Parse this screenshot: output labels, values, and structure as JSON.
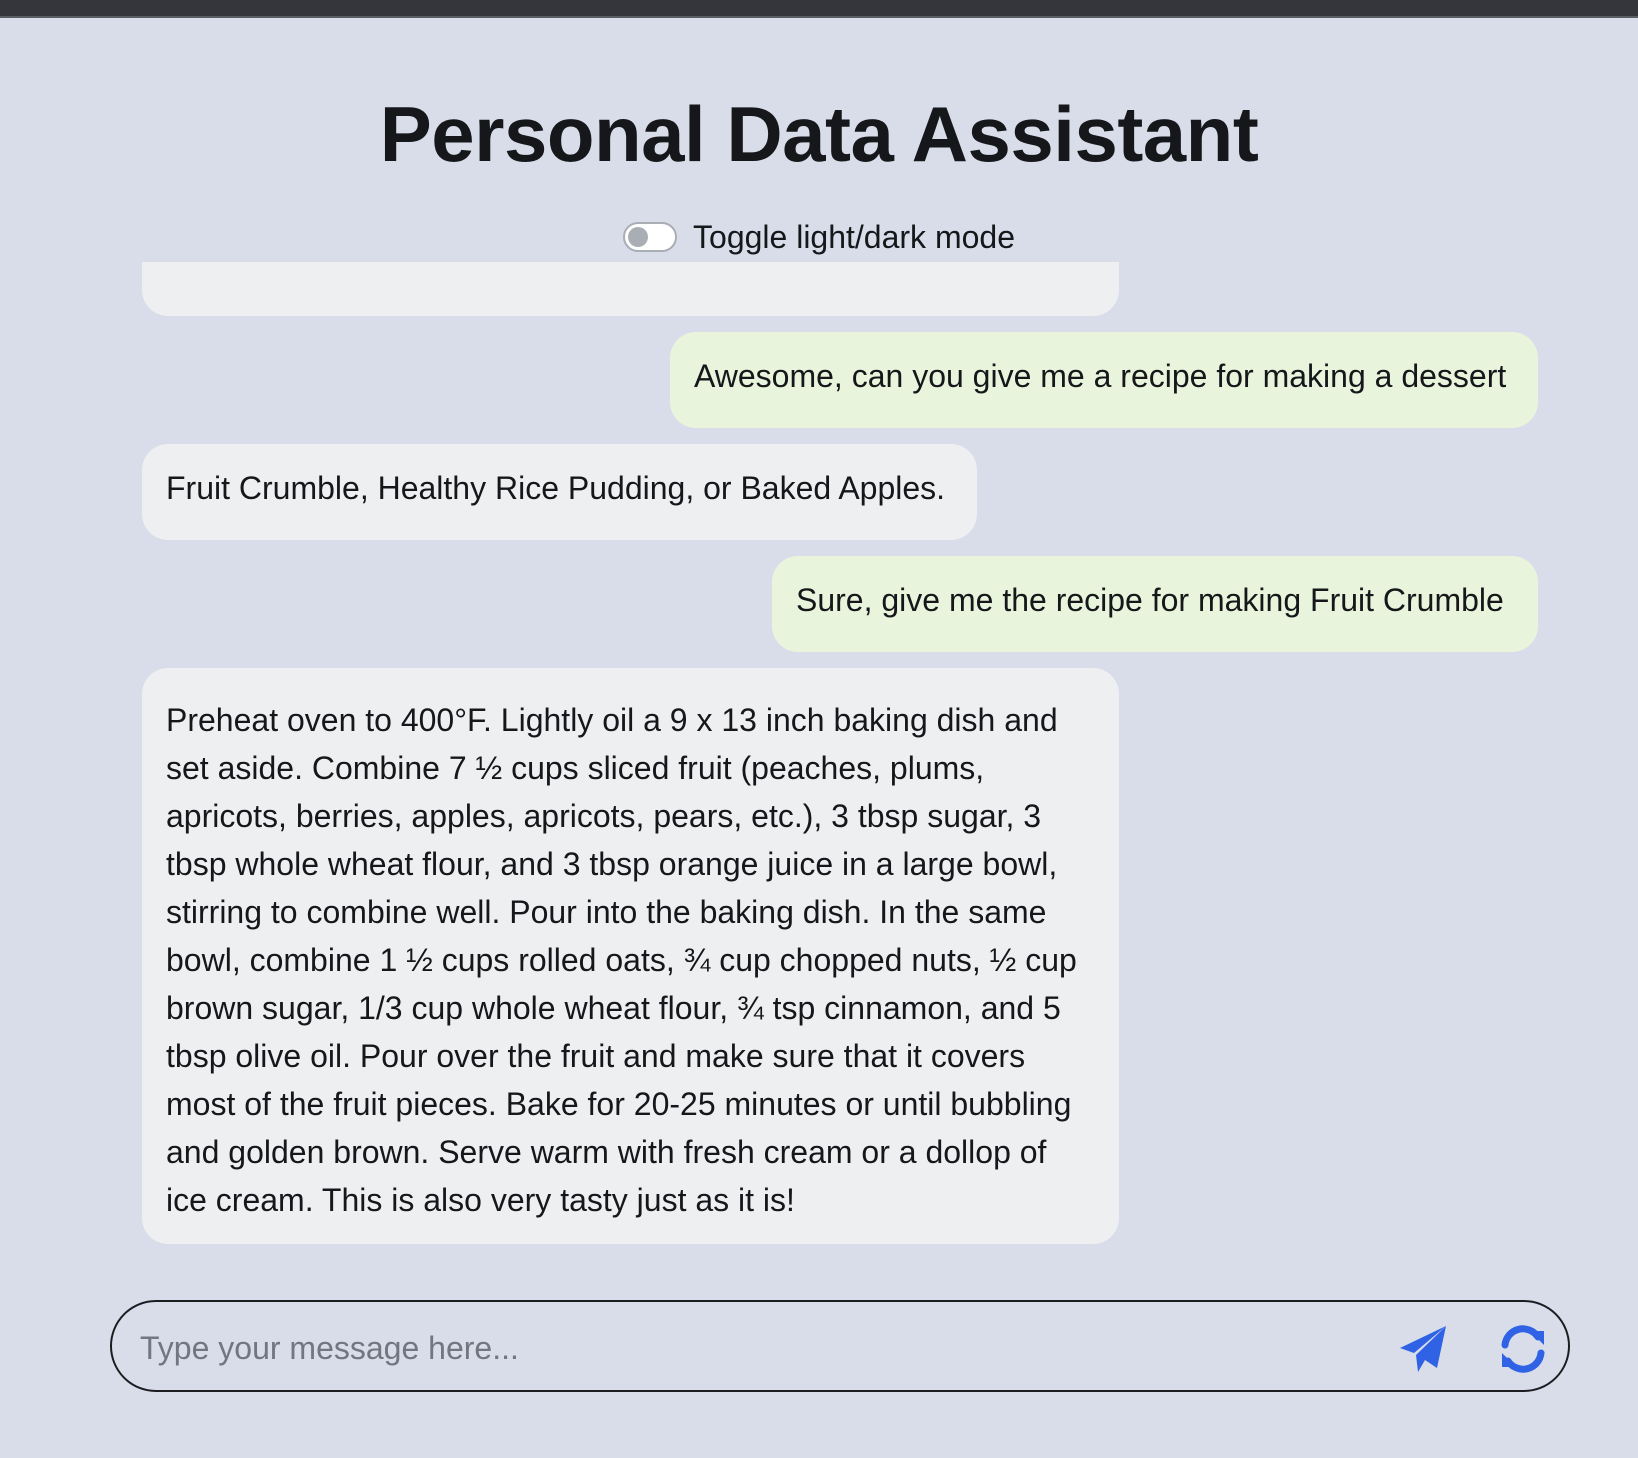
{
  "header": {
    "title": "Personal Data Assistant",
    "toggle_label": "Toggle light/dark mode"
  },
  "messages": [
    {
      "role": "assistant",
      "text": ""
    },
    {
      "role": "user",
      "text": "Awesome, can you give me a recipe for making a dessert"
    },
    {
      "role": "assistant",
      "text": "Fruit Crumble, Healthy Rice Pudding, or Baked Apples."
    },
    {
      "role": "user",
      "text": "Sure, give me the recipe for making Fruit Crumble"
    },
    {
      "role": "assistant",
      "text": "Preheat oven to 400°F. Lightly oil a 9 x 13 inch baking dish and set aside. Combine 7 ½ cups sliced fruit (peaches, plums, apricots, berries, apples, apricots, pears, etc.), 3 tbsp sugar, 3 tbsp whole wheat flour, and 3 tbsp orange juice in a large bowl, stirring to combine well. Pour into the baking dish. In the same bowl, combine 1 ½ cups rolled oats, ¾ cup chopped nuts, ½ cup brown sugar, 1/3 cup whole wheat flour, ¾ tsp cinnamon, and 5 tbsp olive oil. Pour over the fruit and make sure that it covers most of the fruit pieces. Bake for 20-25 minutes or until bubbling and golden brown. Serve warm with fresh cream or a dollop of ice cream. This is also very tasty just as it is!"
    }
  ],
  "composer": {
    "placeholder": "Type your message here...",
    "value": "",
    "send_icon": "paper-plane-icon",
    "refresh_icon": "refresh-icon"
  },
  "theme": {
    "background": "#d8dde9",
    "user_bubble": "#e8f5dc",
    "assistant_bubble": "#eeeff1",
    "accent": "#2f62e4",
    "dark_mode": false
  }
}
